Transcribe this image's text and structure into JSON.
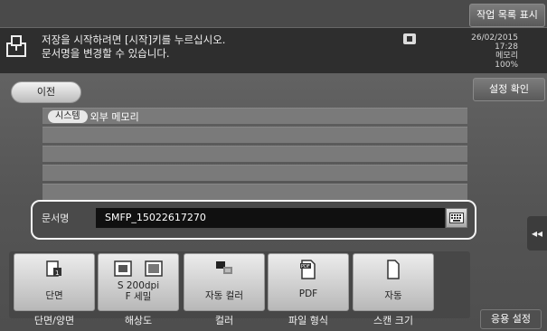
{
  "header": {
    "job_list_button": "작업 목록 표시",
    "message_line1": "저장을 시작하려면 [시작]키를 누르십시오.",
    "message_line2": "문서명을 변경할 수 있습니다.",
    "date": "26/02/2015",
    "time": "17:28",
    "memory_label": "메모리",
    "memory_value": "100%"
  },
  "nav": {
    "prev_button": "이전",
    "settings_confirm_button": "설정 확인"
  },
  "destination_list": {
    "rows": [
      {
        "chip": "시스템",
        "text": "외부 메모리"
      },
      {
        "chip": "",
        "text": ""
      },
      {
        "chip": "",
        "text": ""
      },
      {
        "chip": "",
        "text": ""
      },
      {
        "chip": "",
        "text": ""
      }
    ]
  },
  "filename": {
    "label": "문서명",
    "value": "SMFP_15022617270"
  },
  "side_tab": "◂◂",
  "function_buttons": [
    {
      "value": "단면",
      "caption": "단면/양면",
      "icon": "simplex-icon"
    },
    {
      "value": "S 200dpi\nF 세밀",
      "caption": "해상도",
      "icon": "resolution-icon"
    },
    {
      "value": "자동 컬러",
      "caption": "컬러",
      "icon": "color-icon"
    },
    {
      "value": "PDF",
      "caption": "파일 형식",
      "icon": "pdf-icon"
    },
    {
      "value": "자동",
      "caption": "스캔 크기",
      "icon": "page-size-icon"
    }
  ],
  "application_button": "응용 설정"
}
